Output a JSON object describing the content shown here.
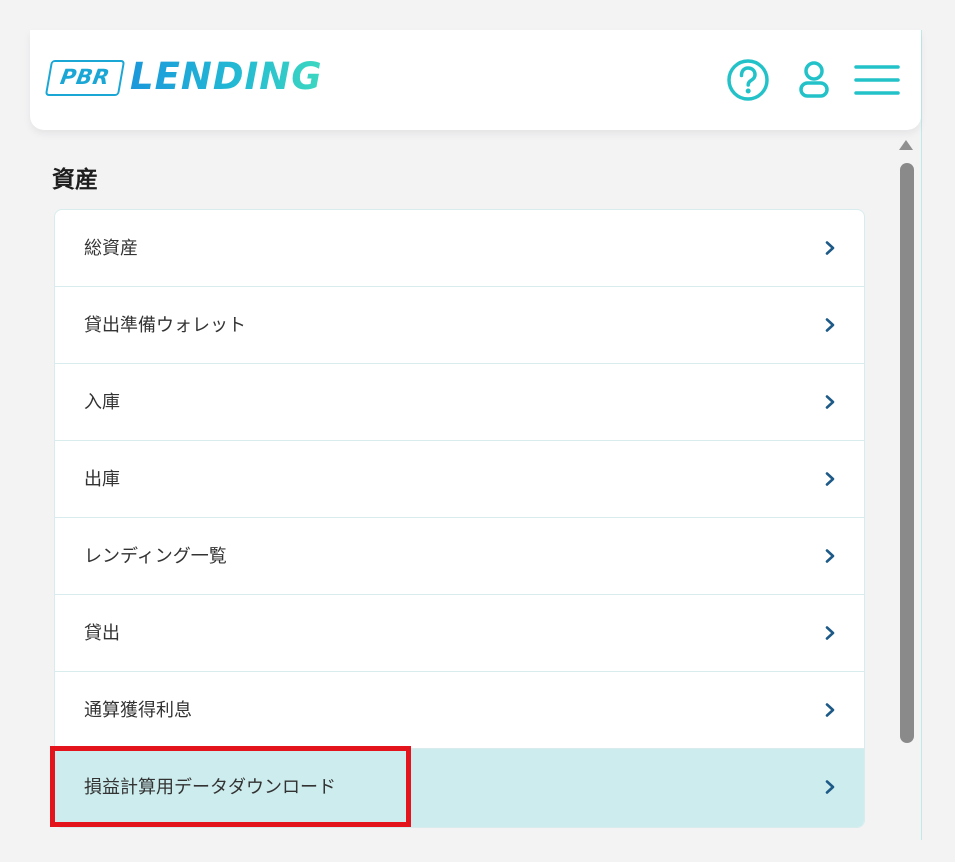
{
  "header": {
    "logo_box_text": "PBR",
    "logo_text": "LENDING",
    "icons": [
      "help-icon",
      "user-icon",
      "menu-icon"
    ]
  },
  "section": {
    "title": "資産"
  },
  "menu": {
    "items": [
      {
        "label": "総資産",
        "active": false
      },
      {
        "label": "貸出準備ウォレット",
        "active": false
      },
      {
        "label": "入庫",
        "active": false
      },
      {
        "label": "出庫",
        "active": false
      },
      {
        "label": "レンディング一覧",
        "active": false
      },
      {
        "label": "貸出",
        "active": false
      },
      {
        "label": "通算獲得利息",
        "active": false
      },
      {
        "label": "損益計算用データダウンロード",
        "active": true
      }
    ]
  },
  "colors": {
    "accent": "#23c2c9",
    "logo_blue": "#1aa7d6",
    "logo_green": "#3dd8c0",
    "active_bg": "#cdeced",
    "highlight": "#e3141b",
    "chevron": "#1e5a87"
  }
}
